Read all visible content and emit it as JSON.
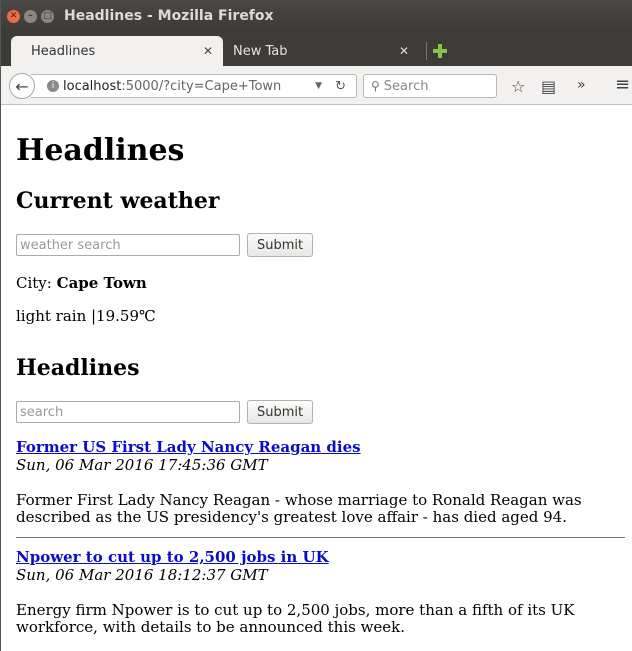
{
  "window": {
    "title": "Headlines - Mozilla Firefox"
  },
  "tabs": [
    {
      "label": "Headlines",
      "active": true
    },
    {
      "label": "New Tab",
      "active": false
    }
  ],
  "navbar": {
    "url_host": "localhost",
    "url_rest": ":5000/?city=Cape+Town",
    "search_placeholder": "Search"
  },
  "page": {
    "title": "Headlines",
    "weather": {
      "heading": "Current weather",
      "search_placeholder": "weather search",
      "submit_label": "Submit",
      "city_label": "City:",
      "city_value": "Cape Town",
      "description": "light rain |19.59℃"
    },
    "headlines": {
      "heading": "Headlines",
      "search_placeholder": "search",
      "submit_label": "Submit",
      "articles": [
        {
          "title": "Former US First Lady Nancy Reagan dies",
          "date": "Sun, 06 Mar 2016 17:45:36 GMT",
          "description": "Former First Lady Nancy Reagan - whose marriage to Ronald Reagan was described as the US presidency's greatest love affair - has died aged 94."
        },
        {
          "title": "Npower to cut up to 2,500 jobs in UK",
          "date": "Sun, 06 Mar 2016 18:12:37 GMT",
          "description": "Energy firm Npower is to cut up to 2,500 jobs, more than a fifth of its UK workforce, with details to be announced this week."
        }
      ]
    }
  },
  "colors": {
    "link": "#0b0bcc",
    "titlebar": "#3c3b37",
    "close_button": "#f06c43",
    "new_tab_plus": "#8bc34a"
  }
}
